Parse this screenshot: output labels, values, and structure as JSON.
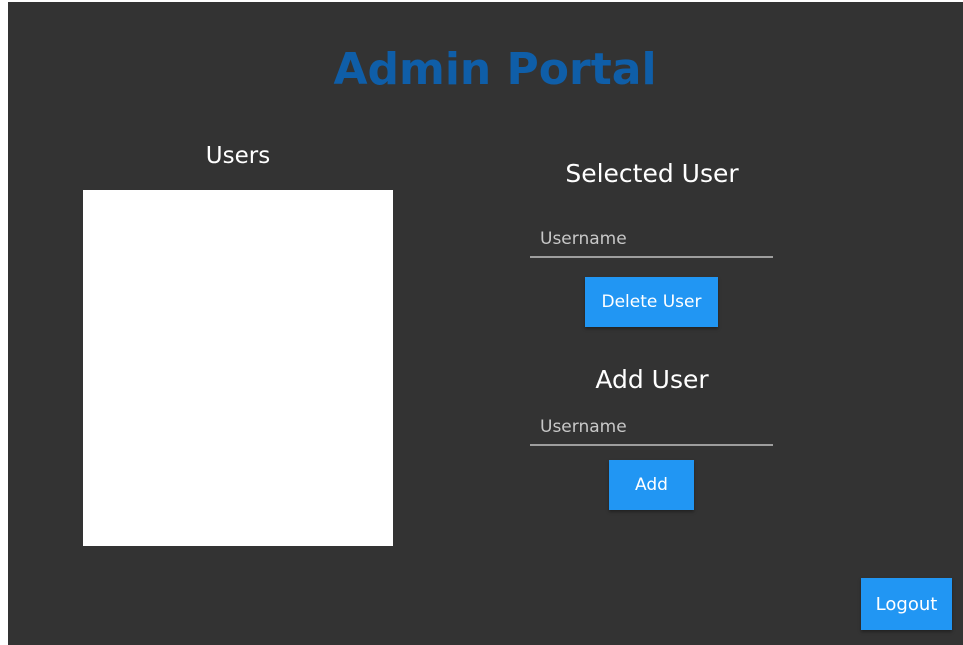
{
  "app": {
    "title": "Admin Portal"
  },
  "users_panel": {
    "heading": "Users",
    "items": []
  },
  "selected_user": {
    "heading": "Selected User",
    "username_placeholder": "Username",
    "username_value": "",
    "delete_label": "Delete User"
  },
  "add_user": {
    "heading": "Add User",
    "username_placeholder": "Username",
    "username_value": "",
    "add_label": "Add"
  },
  "footer": {
    "logout_label": "Logout"
  },
  "colors": {
    "background": "#333333",
    "title": "#0f5ea8",
    "button": "#2196f3",
    "list_background": "#ffffff"
  }
}
